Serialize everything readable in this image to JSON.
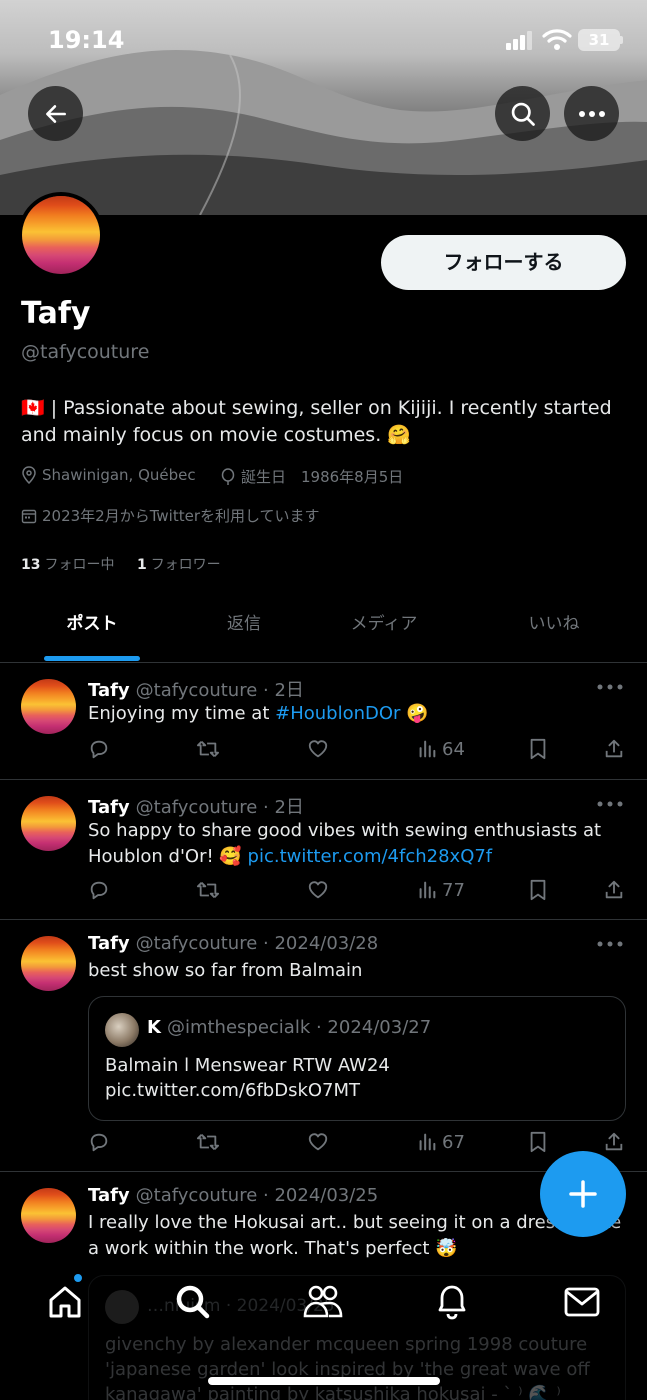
{
  "status_bar": {
    "time": "19:14",
    "battery": "31"
  },
  "header_actions": {
    "back_icon": "arrow-left-icon",
    "search_icon": "search-icon",
    "more_icon": "more-horizontal-icon"
  },
  "profile": {
    "follow_label": "フォローする",
    "name": "Tafy",
    "handle": "@tafycouture",
    "bio": "🇨🇦 | Passionate about sewing, seller on Kijiji. I recently started and mainly focus on movie costumes. 🤗",
    "location": "Shawinigan, Québec",
    "birthday": "誕生日　1986年8月5日",
    "joined": "2023年2月からTwitterを利用しています",
    "following_count": "13",
    "following_label": "フォロー中",
    "followers_count": "1",
    "followers_label": "フォロワー"
  },
  "tabs": [
    {
      "label": "ポスト",
      "active": true
    },
    {
      "label": "返信",
      "active": false
    },
    {
      "label": "メディア",
      "active": false
    },
    {
      "label": "いいね",
      "active": false
    }
  ],
  "posts": [
    {
      "name": "Tafy",
      "handle_time": "@tafycouture · 2日",
      "text_before": "Enjoying my time at ",
      "link": "#HoublonDOr",
      "text_after": " 🤪",
      "views": "64"
    },
    {
      "name": "Tafy",
      "handle_time": "@tafycouture · 2日",
      "text_before": "So happy to share good vibes with sewing enthusiasts at Houblon d'Or! 🥰 ",
      "link": "pic.twitter.com/4fch28xQ7f",
      "text_after": "",
      "views": "77"
    },
    {
      "name": "Tafy",
      "handle_time": "@tafycouture · 2024/03/28",
      "text": "best show so far from Balmain",
      "quote": {
        "name": "K",
        "handle_time": "@imthespecialk · 2024/03/27",
        "text": "Balmain l Menswear RTW AW24 pic.twitter.com/6fbDskO7MT"
      },
      "views": "67"
    },
    {
      "name": "Tafy",
      "handle_time": "@tafycouture · 2024/03/25",
      "text": "I really love the Hokusai art.. but seeing it on a dress is like a work within the work. That's perfect 🤯",
      "quote": {
        "handle_time": "…niuism · 2024/03/25",
        "text": "givenchy by alexander mcqueen spring 1998 couture 'japanese garden' look inspired by 'the great wave off kanagawa' painting by katsushika hokusai - ` ⁾ 🌊 ⁾"
      }
    }
  ],
  "colors": {
    "accent": "#1d9bf0",
    "background": "#000000",
    "muted": "#71767b",
    "divider": "#2f3336"
  },
  "bottom_nav": [
    "home-icon",
    "search-icon",
    "communities-icon",
    "notifications-icon",
    "messages-icon"
  ]
}
